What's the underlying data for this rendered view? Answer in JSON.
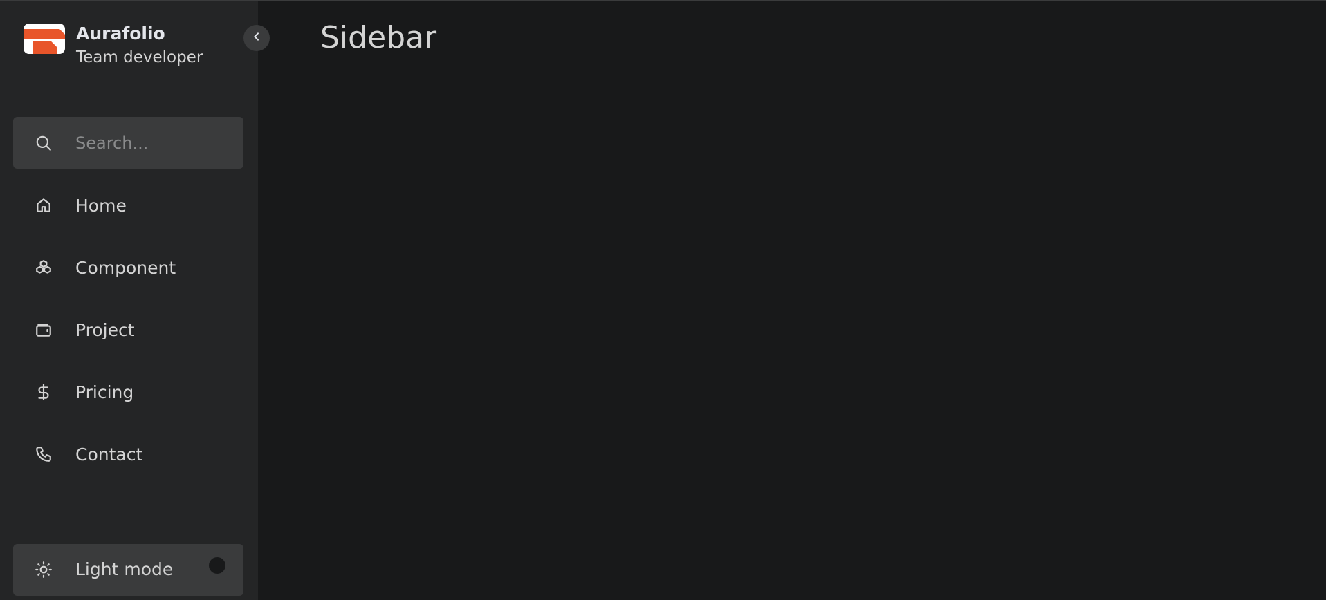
{
  "brand": {
    "name": "Aurafolio",
    "subtitle": "Team developer",
    "logo_color": "#e8552a"
  },
  "search": {
    "placeholder": "Search..."
  },
  "nav": {
    "items": [
      {
        "label": "Home",
        "icon": "home-icon"
      },
      {
        "label": "Component",
        "icon": "component-icon"
      },
      {
        "label": "Project",
        "icon": "wallet-icon"
      },
      {
        "label": "Pricing",
        "icon": "dollar-icon"
      },
      {
        "label": "Contact",
        "icon": "phone-icon"
      }
    ]
  },
  "mode_toggle": {
    "label": "Light mode",
    "icon": "sun-icon"
  },
  "main": {
    "title": "Sidebar"
  },
  "colors": {
    "background": "#18191a",
    "sidebar": "#242526",
    "panel": "#3a3b3c",
    "text": "#d4d4d4",
    "accent": "#e8552a"
  }
}
